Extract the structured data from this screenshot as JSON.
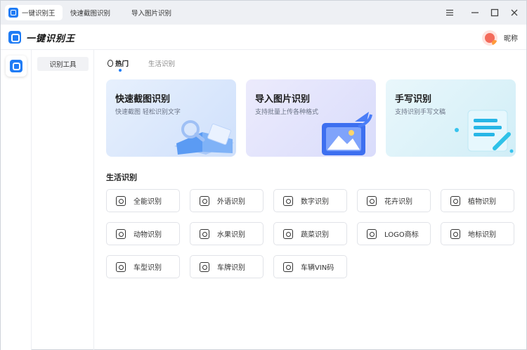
{
  "titlebar": {
    "tabs": [
      {
        "label": "一键识别王",
        "active": true
      },
      {
        "label": "快速截图识别",
        "active": false
      },
      {
        "label": "导入图片识别",
        "active": false
      }
    ]
  },
  "header": {
    "app_name": "一键识别王",
    "nickname": "昵称"
  },
  "sidebar": {
    "tool_label": "识别工具"
  },
  "content_tabs": [
    {
      "label": "热门",
      "active": true
    },
    {
      "label": "生活识别",
      "active": false
    }
  ],
  "cards": [
    {
      "title": "快速截图识别",
      "subtitle": "快速截图 轻松识别文字"
    },
    {
      "title": "导入图片识别",
      "subtitle": "支持批量上传各种格式"
    },
    {
      "title": "手写识别",
      "subtitle": "支持识别手写文稿"
    }
  ],
  "section_title": "生活识别",
  "grid_items": [
    {
      "label": "全能识别",
      "icon": "eye-icon"
    },
    {
      "label": "外语识别",
      "icon": "abc-icon"
    },
    {
      "label": "数字识别",
      "icon": "number-123-icon"
    },
    {
      "label": "花卉识别",
      "icon": "flower-icon"
    },
    {
      "label": "植物识别",
      "icon": "plant-icon"
    },
    {
      "label": "动物识别",
      "icon": "animal-icon"
    },
    {
      "label": "水果识别",
      "icon": "fruit-icon"
    },
    {
      "label": "蔬菜识别",
      "icon": "vegetable-icon"
    },
    {
      "label": "LOGO商标",
      "icon": "logo-tm-icon"
    },
    {
      "label": "地标识别",
      "icon": "landmark-icon"
    },
    {
      "label": "车型识别",
      "icon": "car-icon"
    },
    {
      "label": "车牌识别",
      "icon": "license-plate-icon"
    },
    {
      "label": "车辆VIN码",
      "icon": "vin-icon"
    }
  ],
  "colors": {
    "accent": "#1f7cf5"
  }
}
